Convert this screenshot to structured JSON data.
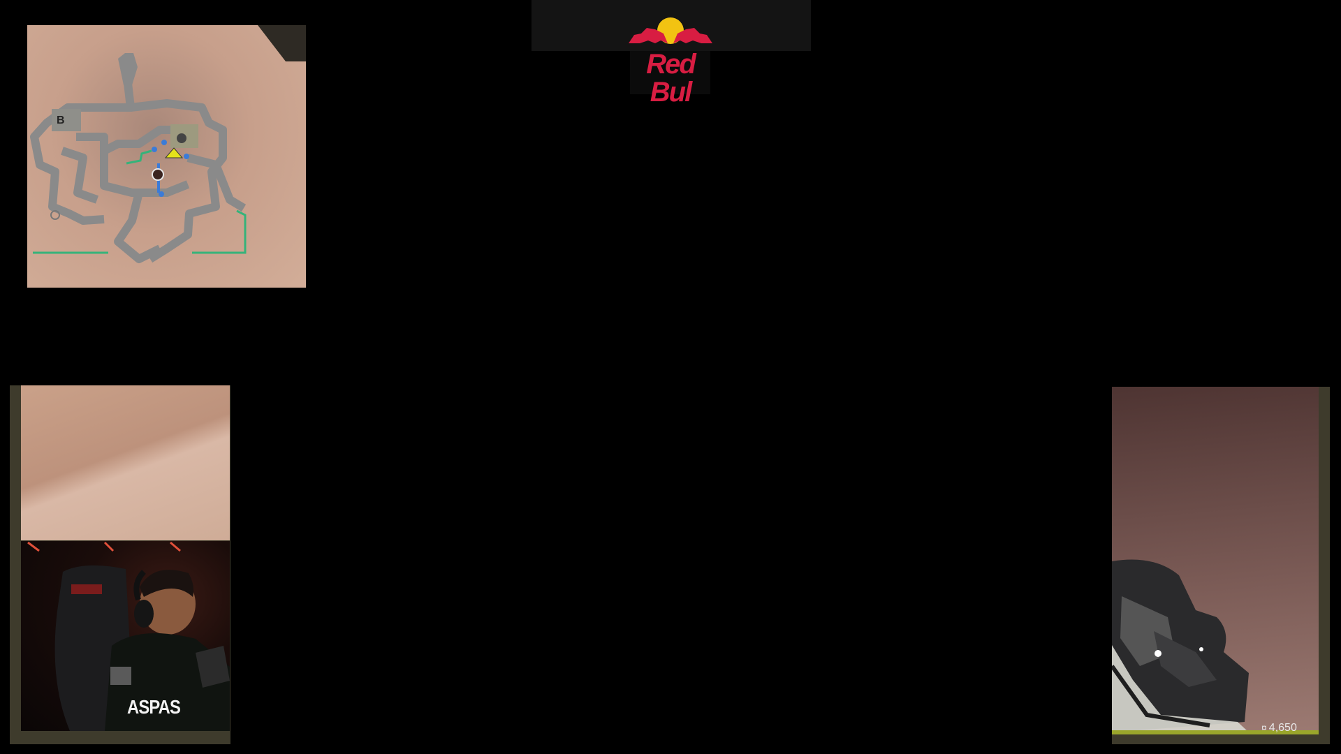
{
  "sponsor": {
    "name": "Red Bull",
    "logo_text": "Red Bul"
  },
  "minimap": {
    "site_label": "B"
  },
  "player_cam": {
    "name": "ASPAS"
  },
  "weapon_panel": {
    "credits": "4,650",
    "credits_icon": "credits-icon"
  },
  "colors": {
    "sponsor_red": "#d81d42",
    "sponsor_yellow": "#f2c312",
    "panel_border": "#3e3b2c",
    "ally_line": "#35b37a",
    "ally_marker": "#3b7bd8"
  }
}
